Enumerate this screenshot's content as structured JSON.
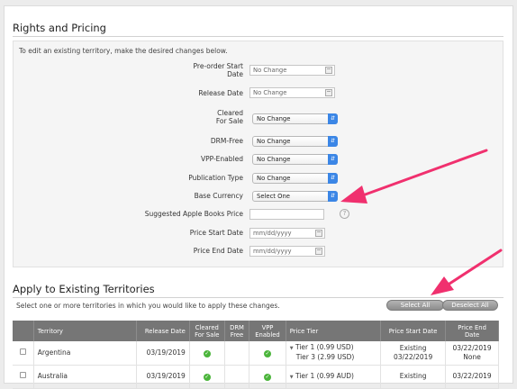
{
  "rights": {
    "title": "Rights and Pricing",
    "instructions": "To edit an existing territory, make the desired changes below.",
    "fields": {
      "preorder_label": "Pre-order Start Date",
      "preorder_value": "No Change",
      "release_label": "Release Date",
      "release_value": "No Change",
      "cleared_label": "Cleared For Sale",
      "cleared_value": "No Change",
      "drm_label": "DRM-Free",
      "drm_value": "No Change",
      "vpp_label": "VPP-Enabled",
      "vpp_value": "No Change",
      "pubtype_label": "Publication Type",
      "pubtype_value": "No Change",
      "currency_label": "Base Currency",
      "currency_value": "Select One",
      "suggested_label": "Suggested Apple Books Price",
      "suggested_value": "",
      "pstart_label": "Price Start Date",
      "pstart_placeholder": "mm/dd/yyyy",
      "pend_label": "Price End Date",
      "pend_placeholder": "mm/dd/yyyy"
    },
    "help_glyph": "?"
  },
  "apply": {
    "title": "Apply to Existing Territories",
    "instructions": "Select one or more territories in which you would like to apply these changes.",
    "select_all": "Select All",
    "deselect_all": "Deselect All",
    "columns": [
      "Territory",
      "Release Date",
      "Cleared For Sale",
      "DRM Free",
      "VPP Enabled",
      "Price Tier",
      "Price Start Date",
      "Price End Date"
    ],
    "rows": [
      {
        "territory": "Argentina",
        "release": "03/19/2019",
        "tier1": "Tier 1 (0.99 USD)",
        "tier2": "Tier 3 (2.99 USD)",
        "pstart1": "Existing",
        "pstart2": "03/22/2019",
        "pend1": "03/22/2019",
        "pend2": "None"
      },
      {
        "territory": "Australia",
        "release": "03/19/2019",
        "tier1": "Tier 1 (0.99 AUD)",
        "tier2": "",
        "pstart1": "Existing",
        "pstart2": "",
        "pend1": "03/22/2019",
        "pend2": ""
      }
    ]
  },
  "colors": {
    "annotation_arrow": "#f0306e",
    "select_accent": "#3b86e6",
    "check_green": "#4bb53b",
    "table_header": "#767676"
  },
  "icons": [
    "calendar-icon",
    "chevron-updown-icon",
    "help-icon",
    "checkmark-icon",
    "disclosure-triangle-icon",
    "annotation-arrow"
  ]
}
